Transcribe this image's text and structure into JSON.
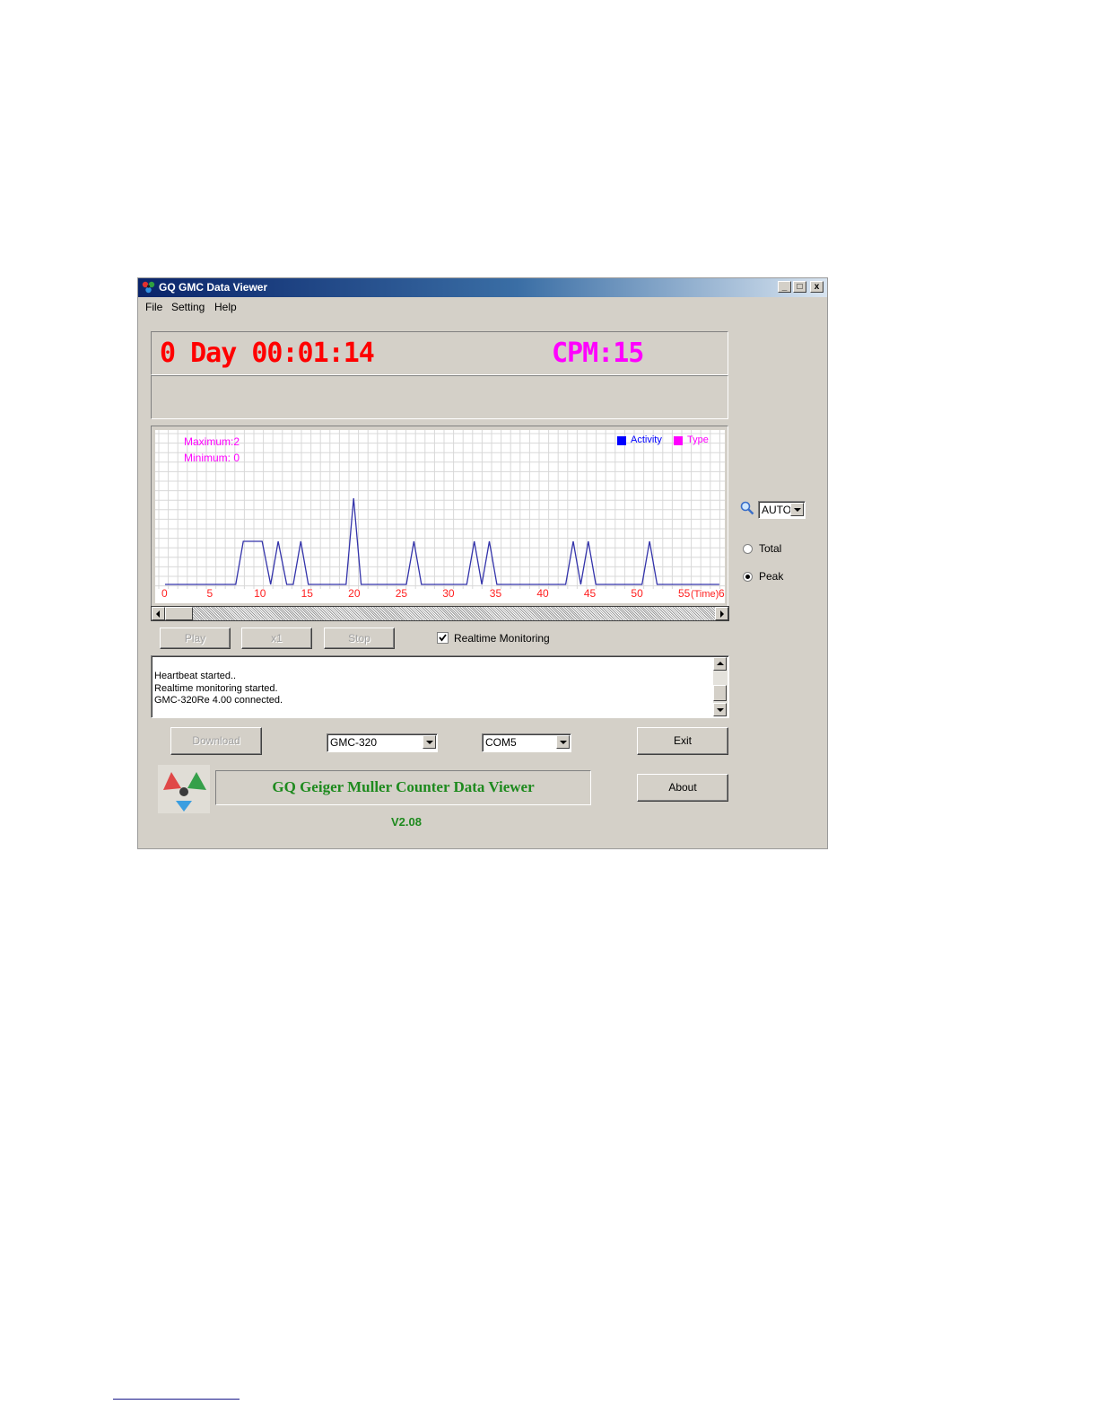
{
  "window": {
    "title": "GQ GMC Data Viewer",
    "controls": [
      "_",
      "□",
      "x"
    ]
  },
  "menu": [
    "File",
    "Setting",
    "Help"
  ],
  "status": {
    "elapsed": "0 Day 00:01:14",
    "cpm": "CPM:15",
    "elapsed_color": "#ff0000",
    "cpm_color": "#ff00ff"
  },
  "chart": {
    "max_label": "Maximum:2",
    "min_label": "Minimum: 0",
    "legend": [
      {
        "name": "Activity",
        "color": "#0000ff"
      },
      {
        "name": "Type",
        "color": "#ff00ff"
      }
    ],
    "x_time_label": "(Time)",
    "x_end_label": "6"
  },
  "chart_data": {
    "type": "line",
    "x_ticks": [
      0,
      5,
      10,
      15,
      20,
      25,
      30,
      35,
      40,
      45,
      50,
      55
    ],
    "xlim": [
      0,
      59
    ],
    "ylim": [
      0,
      2
    ],
    "grid": true,
    "legend_position": "top-right",
    "series": [
      {
        "name": "Activity",
        "color": "#3333aa",
        "x": [
          0,
          7.5,
          8.3,
          10.3,
          11.2,
          12.0,
          12.9,
          13.6,
          14.4,
          15.2,
          16.0,
          16.8,
          19.2,
          20.0,
          20.8,
          25.6,
          26.4,
          27.2,
          32.0,
          32.8,
          33.6,
          34.4,
          35.2,
          36.0,
          42.5,
          43.3,
          44.1,
          44.9,
          45.7,
          46.5,
          50.6,
          51.4,
          52.2,
          58.8
        ],
        "y": [
          0,
          0,
          1,
          1,
          0,
          1,
          0,
          0,
          1,
          0,
          0,
          0,
          0,
          2,
          0,
          0,
          1,
          0,
          0,
          1,
          0,
          1,
          0,
          0,
          0,
          1,
          0,
          1,
          0,
          0,
          0,
          1,
          0,
          0
        ]
      }
    ]
  },
  "zoom": {
    "value": "AUTO"
  },
  "mode": {
    "options": [
      {
        "label": "Total",
        "selected": false
      },
      {
        "label": "Peak",
        "selected": true
      }
    ]
  },
  "playback": {
    "play_label": "Play",
    "speed_label": "x1",
    "stop_label": "Stop",
    "realtime_label": "Realtime Monitoring",
    "realtime_checked": true
  },
  "log": {
    "lines": [
      "Heartbeat started..",
      "Realtime monitoring started.",
      "GMC-320Re 4.00 connected."
    ]
  },
  "bottom": {
    "download_label": "Download",
    "device_value": "GMC-320",
    "port_value": "COM5",
    "exit_label": "Exit",
    "about_label": "About",
    "banner_text": "GQ Geiger Muller Counter Data Viewer",
    "version": "V2.08"
  }
}
